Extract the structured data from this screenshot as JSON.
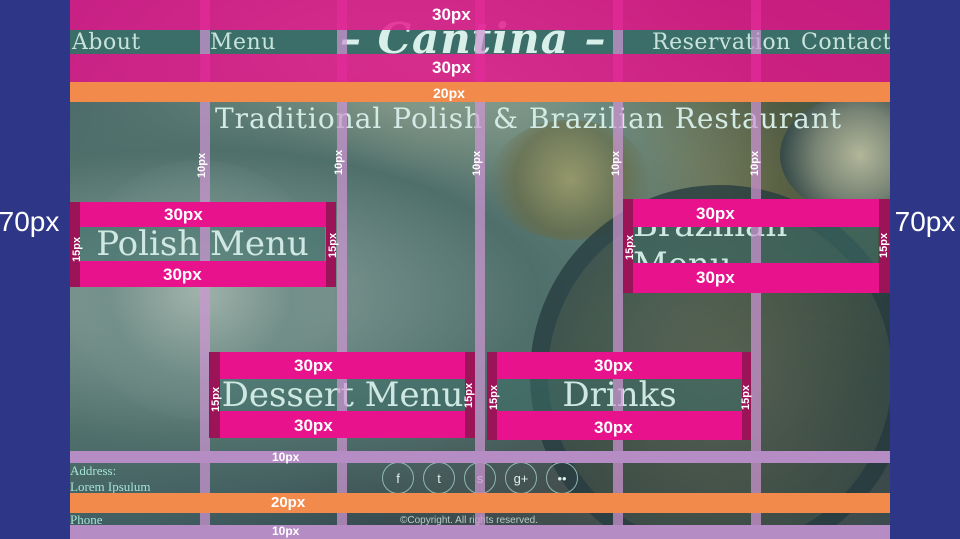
{
  "spacing": {
    "gutter": "70px",
    "top_band": "30px",
    "nav_band": "30px",
    "orange_band": "20px",
    "card_pad": "30px",
    "card_side": "15px",
    "column_gap": "10px",
    "footer_gap": "10px",
    "footer_band": "20px",
    "bottom_gap": "10px"
  },
  "site": {
    "logo": "– Cantina –",
    "tagline": "Traditional Polish & Brazilian Restaurant"
  },
  "nav": {
    "about": "About",
    "menu": "Menu",
    "reservation": "Reservation",
    "contact": "Contact"
  },
  "cards": {
    "polish": "Polish Menu",
    "brazilian": "Brazilian Menu",
    "dessert": "Dessert Menu",
    "drinks": "Drinks"
  },
  "footer": {
    "address_label": "Address:",
    "address_value": "Lorem Ipsulum",
    "phone_label": "Phone",
    "copyright": "©Copyright. All rights reserved.",
    "social": [
      "f",
      "t",
      "s",
      "g+",
      "••"
    ]
  },
  "colors": {
    "gutter": "#2e3687",
    "pink_guide": "#e8128d",
    "orange_guide": "#f28a4c",
    "lilac_guide": "#b58cc3",
    "text_accent": "#cfe9e2"
  }
}
